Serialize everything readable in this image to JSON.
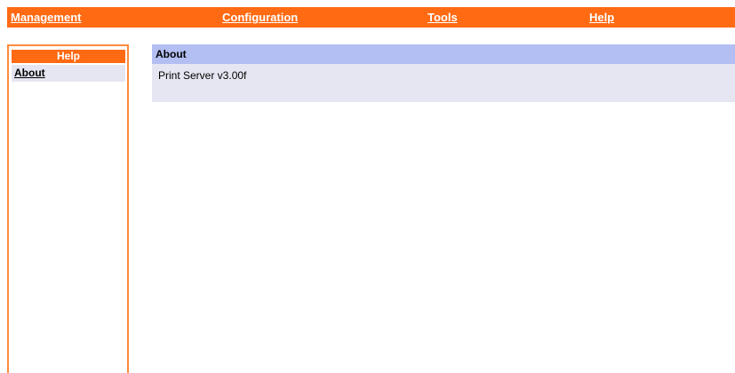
{
  "topnav": {
    "items": [
      {
        "label": "Management"
      },
      {
        "label": "Configuration"
      },
      {
        "label": "Tools"
      },
      {
        "label": "Help"
      }
    ]
  },
  "sidebar": {
    "title": "Help",
    "items": [
      {
        "label": "About"
      }
    ]
  },
  "main": {
    "section_title": "About",
    "body_text": "Print Server v3.00f"
  },
  "colors": {
    "nav_orange": "#ff6a13",
    "sidebar_border": "#ff8a3d",
    "section_header_bg": "#b3bff2",
    "section_body_bg": "#e6e6f2"
  }
}
